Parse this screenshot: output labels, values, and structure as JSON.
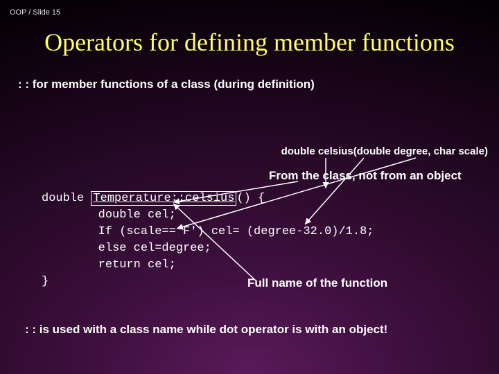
{
  "breadcrumb": "OOP / Slide 15",
  "title": "Operators for defining member functions",
  "subheading": ": : for member functions of a class (during definition)",
  "signature": "double celsius(double degree, char scale)",
  "annotation_top": "From the class, not from an object",
  "code": {
    "line1a": "double ",
    "line1b": "Temperature::celsius",
    "line1c": "() {",
    "line2": "        double cel;",
    "line3": "        If (scale=='F') cel= (degree-32.0)/1.8;",
    "line4": "        else cel=degree;",
    "line5": "        return cel;",
    "line6": "}"
  },
  "annotation_mid": "Full name of the function",
  "footer": ": : is used with a class name while dot operator is with an object!"
}
